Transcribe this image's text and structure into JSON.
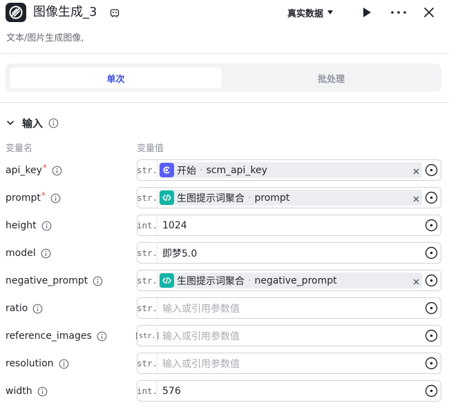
{
  "header": {
    "title": "图像生成_3",
    "data_mode": "真实数据"
  },
  "description": "文本/图片生成图像,",
  "tabs": [
    {
      "label": "单次",
      "active": true
    },
    {
      "label": "批处理",
      "active": false
    }
  ],
  "inputs_section": {
    "title": "输入",
    "col_name": "变量名",
    "col_value": "变量值"
  },
  "placeholder": "输入或引用参数值",
  "colors": {
    "accent": "#3b4cd9",
    "start_node_icon": "#5b5ef7",
    "prompt_node_icon": "#12b5a6",
    "required": "#e5484d"
  },
  "rows": [
    {
      "name": "api_key",
      "required": true,
      "type": "str.",
      "kind": "ref",
      "ref_node": "开始",
      "ref_var": "scm_api_key",
      "ref_icon": "start-node-icon"
    },
    {
      "name": "prompt",
      "required": true,
      "type": "str.",
      "kind": "ref",
      "ref_node": "生图提示词聚合",
      "ref_var": "prompt",
      "ref_icon": "code-node-icon"
    },
    {
      "name": "height",
      "required": false,
      "type": "int.",
      "kind": "value",
      "value": "1024"
    },
    {
      "name": "model",
      "required": false,
      "type": "str.",
      "kind": "value",
      "value": "即梦5.0"
    },
    {
      "name": "negative_prompt",
      "required": false,
      "type": "str.",
      "kind": "ref",
      "ref_node": "生图提示词聚合",
      "ref_var": "negative_prompt",
      "ref_icon": "code-node-icon"
    },
    {
      "name": "ratio",
      "required": false,
      "type": "str.",
      "kind": "empty"
    },
    {
      "name": "reference_images",
      "required": false,
      "type": "[str.]",
      "kind": "empty"
    },
    {
      "name": "resolution",
      "required": false,
      "type": "str.",
      "kind": "empty"
    },
    {
      "name": "width",
      "required": false,
      "type": "int.",
      "kind": "value",
      "value": "576"
    }
  ]
}
